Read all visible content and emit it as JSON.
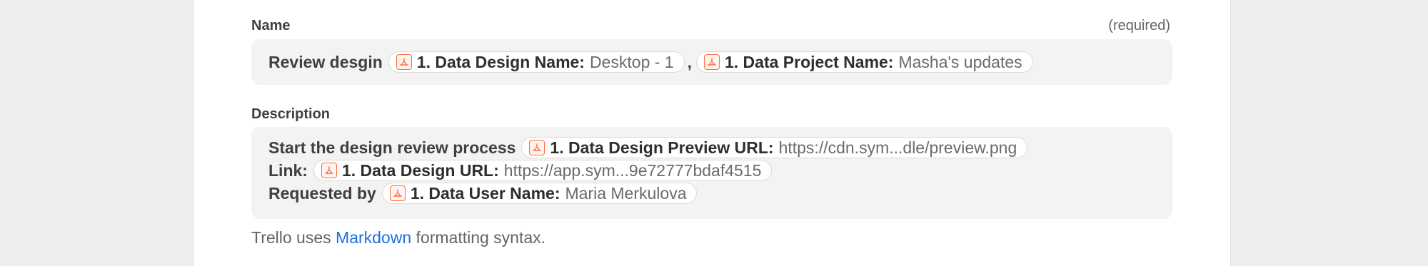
{
  "name_field": {
    "label": "Name",
    "required_text": "(required)",
    "prefix": "Review desgin",
    "separator": ",",
    "pills": [
      {
        "key": "1. Data Design Name:",
        "value": "Desktop - 1",
        "icon": "app-step-icon"
      },
      {
        "key": "1. Data Project Name:",
        "value": "Masha's updates",
        "icon": "app-step-icon"
      }
    ]
  },
  "description_field": {
    "label": "Description",
    "lines": [
      {
        "prefix": "Start the design review process",
        "pill": {
          "key": "1. Data Design Preview URL:",
          "value": "https://cdn.sym...dle/preview.png"
        }
      },
      {
        "prefix": "Link:",
        "pill": {
          "key": "1. Data Design URL:",
          "value": "https://app.sym...9e72777bdaf4515"
        }
      },
      {
        "prefix": "Requested by",
        "pill": {
          "key": "1. Data User Name:",
          "value": "Maria Merkulova"
        }
      }
    ]
  },
  "help": {
    "before": "Trello uses",
    "link": "Markdown",
    "after": "formatting syntax."
  },
  "colors": {
    "accent": "#ff6a3d",
    "link": "#1f6fe0",
    "field_bg": "#f3f3f3"
  }
}
